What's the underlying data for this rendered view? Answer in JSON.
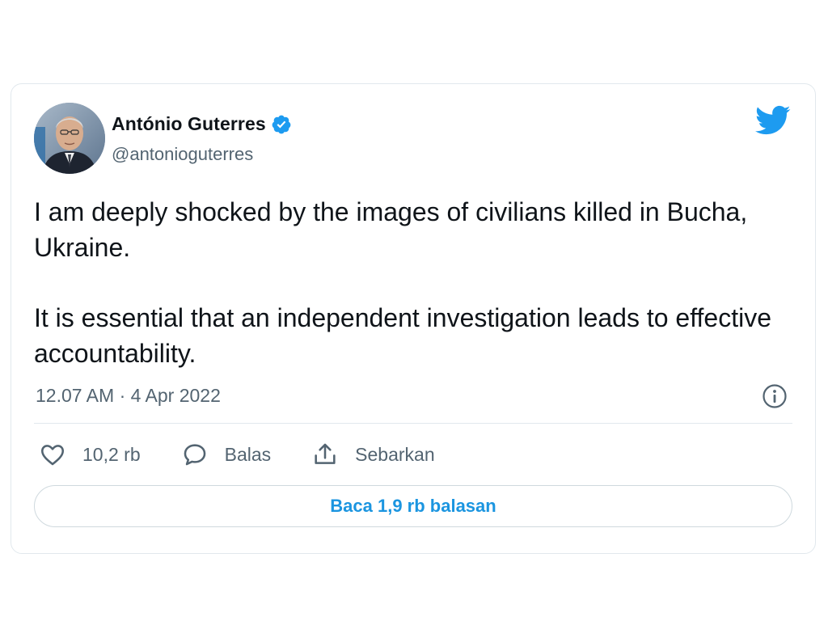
{
  "author": {
    "display_name": "António Guterres",
    "handle": "@antonioguterres",
    "verified": true
  },
  "tweet": {
    "paragraphs": [
      "I am deeply shocked by the images of civilians killed in Bucha, Ukraine.",
      "It is essential that an independent investigation leads to effective accountability."
    ],
    "timestamp": "12.07 AM · 4 Apr 2022"
  },
  "actions": {
    "like_count": "10,2 rb",
    "reply_label": "Balas",
    "share_label": "Sebarkan"
  },
  "read_replies_label": "Baca 1,9 rb balasan",
  "icons": {
    "brand": "twitter-bird-icon",
    "verified": "verified-badge-icon",
    "info": "info-icon",
    "like": "heart-icon",
    "reply": "speech-bubble-icon",
    "share": "share-icon"
  },
  "colors": {
    "brand_blue": "#1d9bf0",
    "link_blue": "#1b95e0",
    "text_primary": "#0f1419",
    "text_secondary": "#536471",
    "border": "#e1e8ed"
  }
}
